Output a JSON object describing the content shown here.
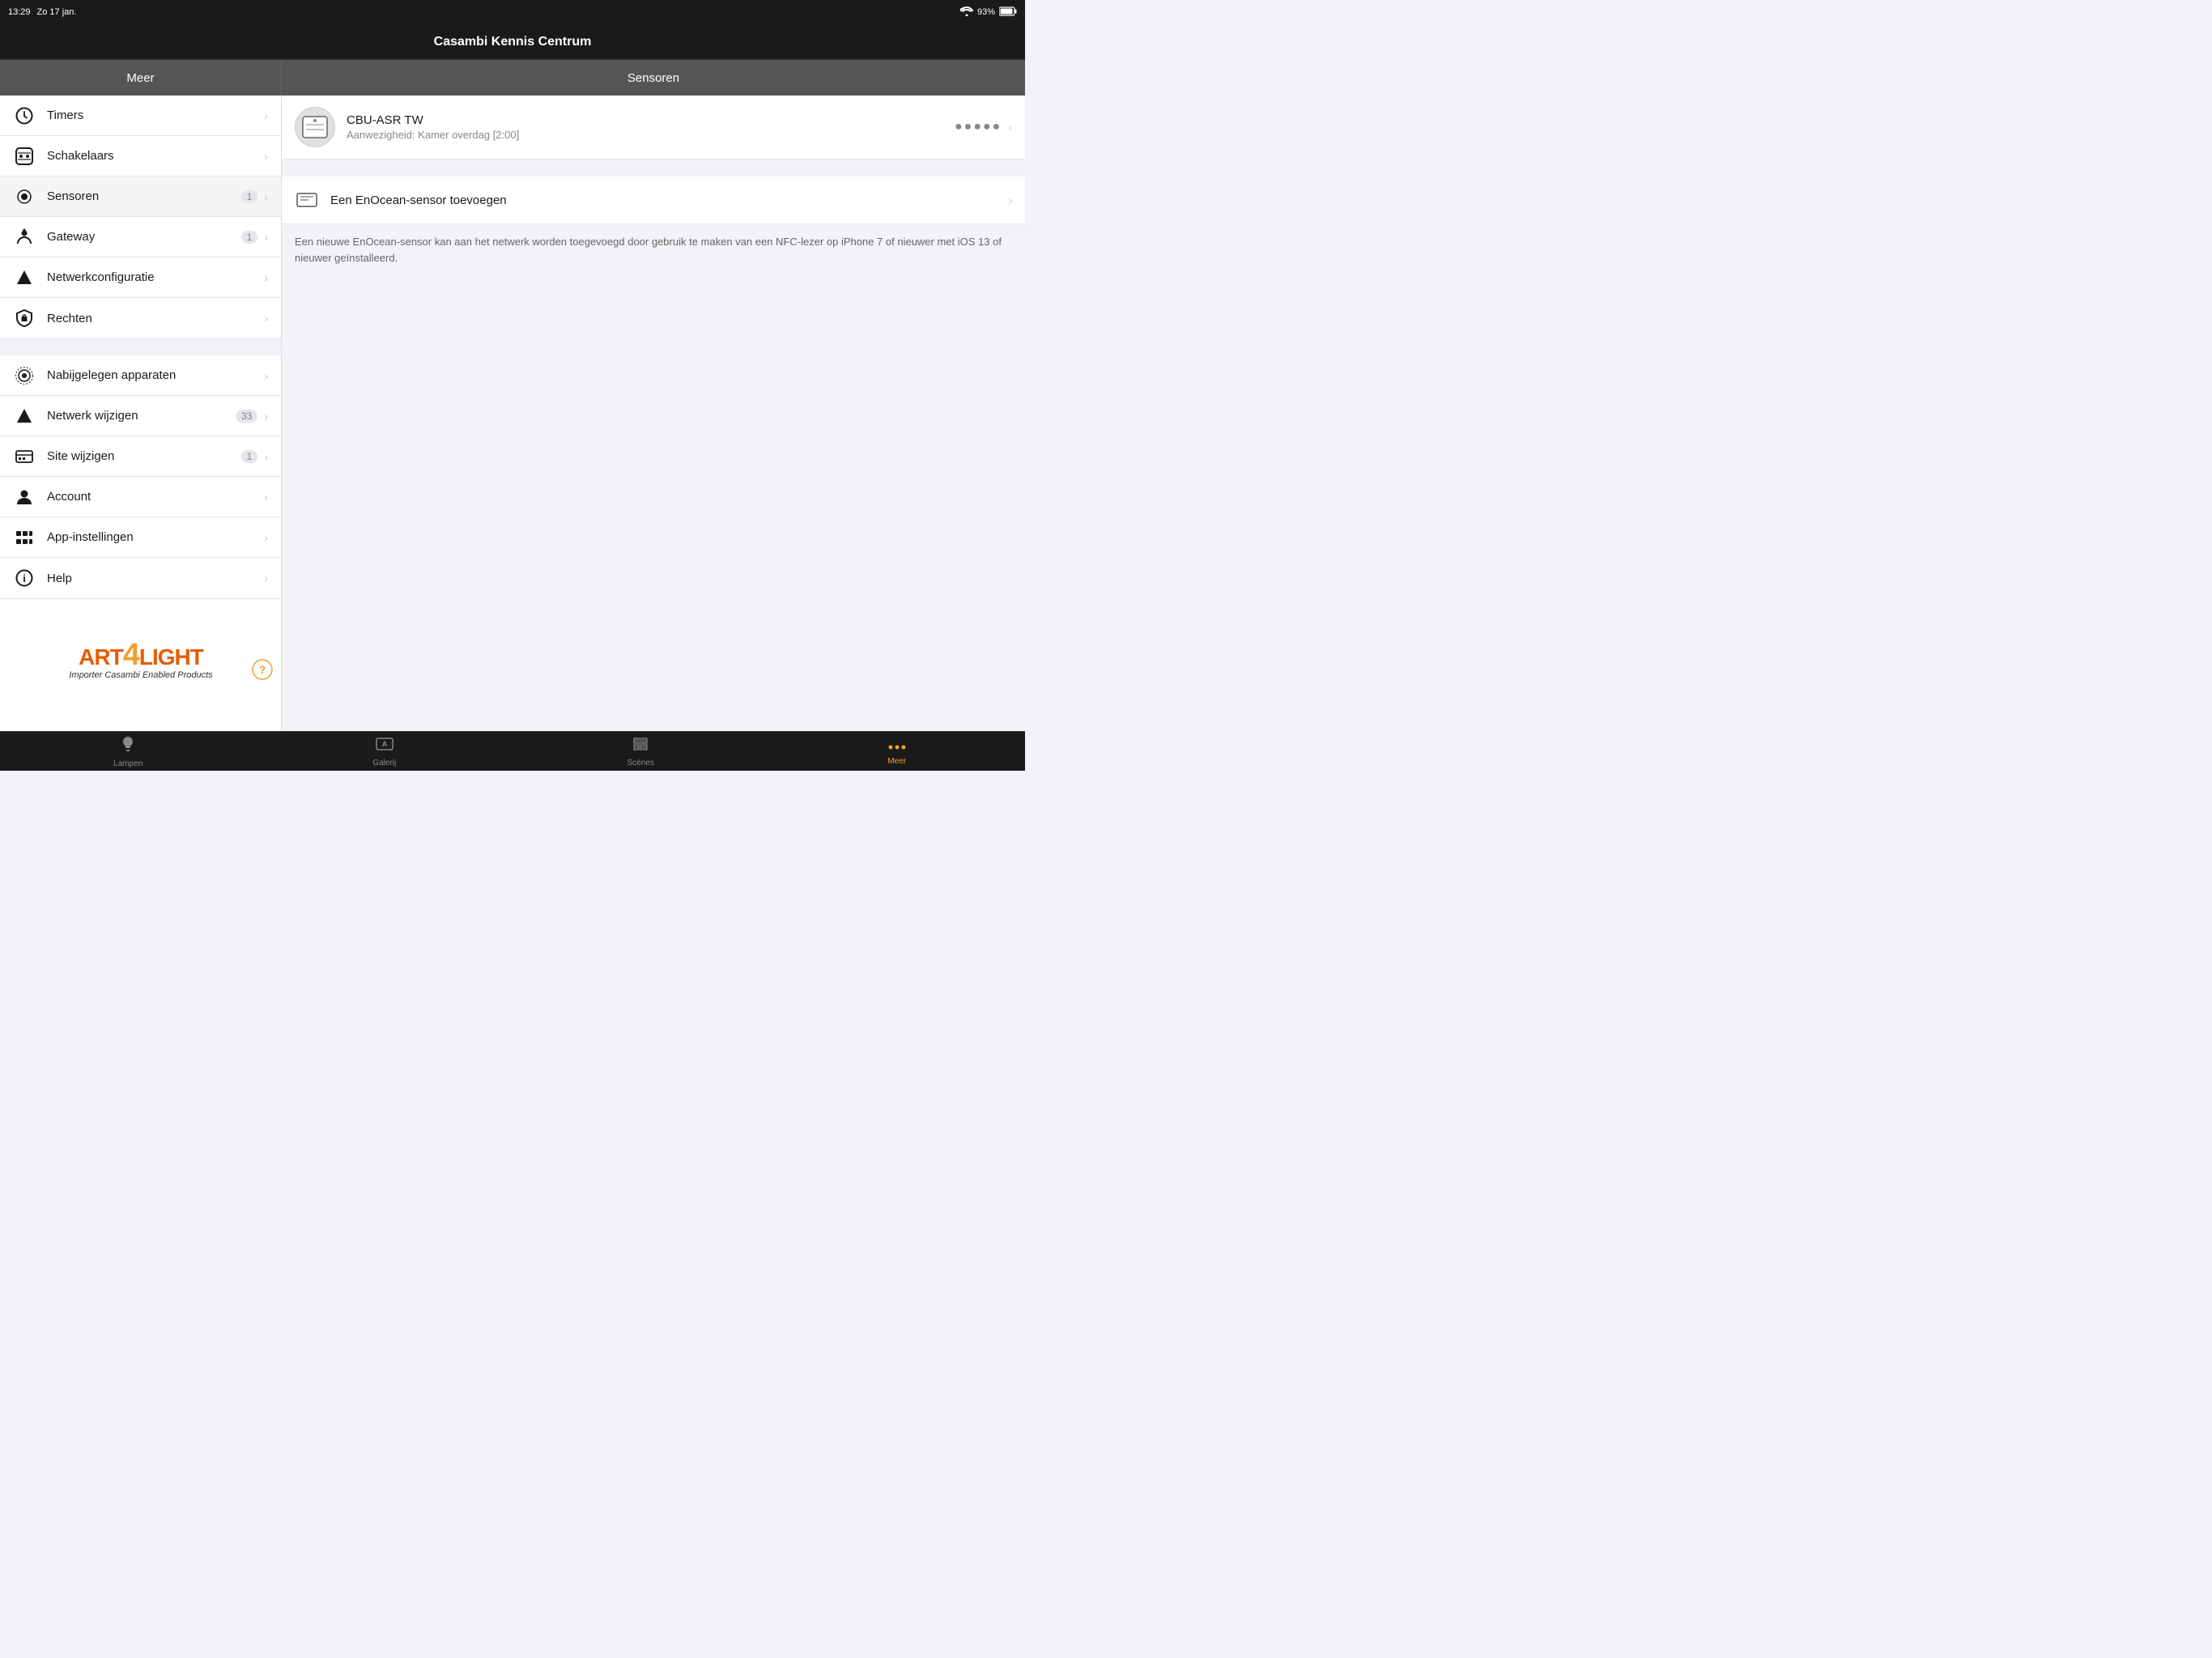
{
  "statusBar": {
    "time": "13:29",
    "date": "Zo 17 jan.",
    "wifi": "wifi",
    "battery": "93%"
  },
  "titleBar": {
    "title": "Casambi Kennis Centrum"
  },
  "headers": {
    "left": "Meer",
    "right": "Sensoren"
  },
  "sidebar": {
    "section1": [
      {
        "id": "timers",
        "label": "Timers",
        "icon": "clock",
        "badge": null
      },
      {
        "id": "schakelaars",
        "label": "Schakelaars",
        "icon": "switch",
        "badge": null
      },
      {
        "id": "sensoren",
        "label": "Sensoren",
        "icon": "sensor",
        "badge": "1"
      },
      {
        "id": "gateway",
        "label": "Gateway",
        "icon": "gateway",
        "badge": "1"
      },
      {
        "id": "netwerkconfiguratie",
        "label": "Netwerkconfiguratie",
        "icon": "network",
        "badge": null
      },
      {
        "id": "rechten",
        "label": "Rechten",
        "icon": "shield",
        "badge": null
      }
    ],
    "section2": [
      {
        "id": "nabijgelegen",
        "label": "Nabijgelegen apparaten",
        "icon": "nearby",
        "badge": null
      },
      {
        "id": "netwerk-wijzigen",
        "label": "Netwerk wijzigen",
        "icon": "network2",
        "badge": "33"
      },
      {
        "id": "site-wijzigen",
        "label": "Site wijzigen",
        "icon": "site",
        "badge": "1"
      },
      {
        "id": "account",
        "label": "Account",
        "icon": "account",
        "badge": null
      },
      {
        "id": "app-instellingen",
        "label": "App-instellingen",
        "icon": "settings",
        "badge": null
      },
      {
        "id": "help",
        "label": "Help",
        "icon": "help",
        "badge": null
      }
    ]
  },
  "rightPanel": {
    "sensor": {
      "name": "CBU-ASR TW",
      "sub": "Aanwezigheid: Kamer overdag [2:00]",
      "dots": "●●●●●"
    },
    "addSensor": {
      "label": "Een EnOcean-sensor toevoegen",
      "description": "Een nieuwe EnOcean-sensor kan aan het netwerk worden toegevoegd door gebruik te maken van een NFC-lezer op iPhone 7 of nieuwer met iOS 13 of nieuwer geïnstalleerd."
    }
  },
  "tabBar": [
    {
      "id": "lampen",
      "label": "Lampen",
      "icon": "lamp",
      "active": false
    },
    {
      "id": "galerij",
      "label": "Galerij",
      "icon": "gallery",
      "active": false
    },
    {
      "id": "scenes",
      "label": "Scènes",
      "icon": "scenes",
      "active": false
    },
    {
      "id": "meer",
      "label": "Meer",
      "icon": "more",
      "active": true
    }
  ]
}
